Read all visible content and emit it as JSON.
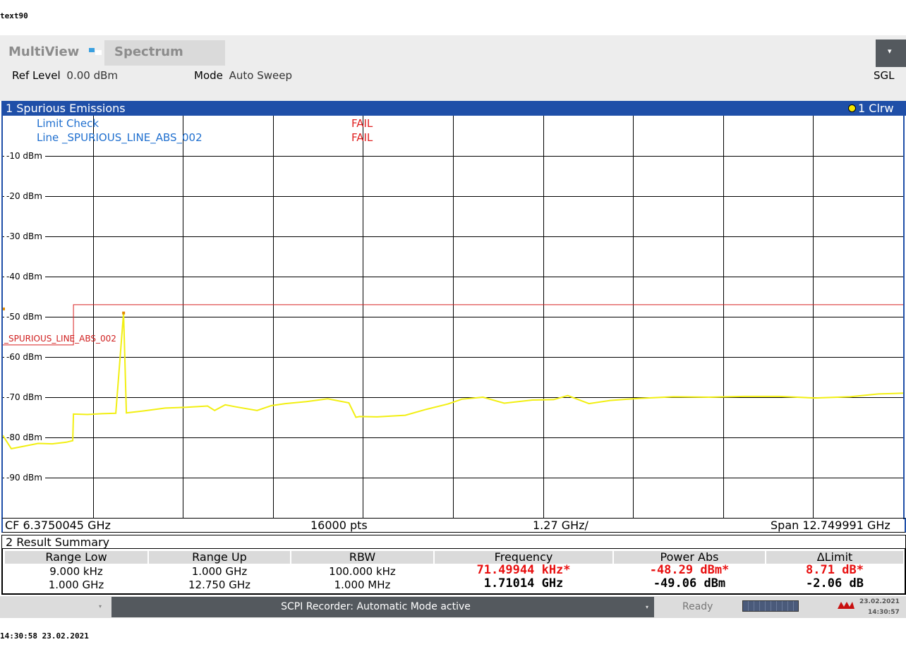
{
  "captions": {
    "top": "text90",
    "bottom": "14:30:58  23.02.2021"
  },
  "header": {
    "app": "MultiView",
    "tab": "Spectrum",
    "ref_level_label": "Ref Level",
    "ref_level_value": "0.00 dBm",
    "mode_label": "Mode",
    "mode_value": "Auto Sweep",
    "sgl": "SGL",
    "menu_glyph": "▾"
  },
  "window1": {
    "title": "1 Spurious Emissions",
    "trace_label": "1 Clrw",
    "limit_check_label": "Limit Check",
    "limit_check_result": "FAIL",
    "limit_line_label": "Line _SPURIOUS_LINE_ABS_002",
    "limit_line_result": "FAIL",
    "line_marker_label": "_SPURIOUS_LINE_ABS_002",
    "footer": {
      "cf": "CF 6.3750045 GHz",
      "pts": "16000 pts",
      "div": "1.27 GHz/",
      "span": "Span 12.749991 GHz"
    }
  },
  "chart_data": {
    "type": "line",
    "y_unit": "dBm",
    "ylim": [
      -100,
      0
    ],
    "xlim_ghz": [
      0.0,
      12.75
    ],
    "yticks": [
      "-10 dBm",
      "-20 dBm",
      "-30 dBm",
      "-40 dBm",
      "-50 dBm",
      "-60 dBm",
      "-70 dBm",
      "-80 dBm",
      "-90 dBm"
    ],
    "ytick_values": [
      -10,
      -20,
      -30,
      -40,
      -50,
      -60,
      -70,
      -80,
      -90
    ],
    "grid": true,
    "colors": {
      "trace": "#f2ef12",
      "limit": "#d82020",
      "marker": "#e08a00",
      "grid": "#000000"
    },
    "series": [
      {
        "x_ghz": [
          0.0,
          0.12,
          0.3,
          0.5,
          0.7,
          0.9,
          0.99,
          1.0,
          1.2,
          1.4,
          1.6,
          1.7101,
          1.75,
          2.0,
          2.3,
          2.6,
          2.9,
          3.0,
          3.15,
          3.3,
          3.6,
          3.8,
          4.0,
          4.3,
          4.6,
          4.9,
          5.0,
          5.05,
          5.3,
          5.7,
          6.0,
          6.3,
          6.5,
          6.8,
          7.1,
          7.5,
          7.8,
          8.0,
          8.3,
          8.6,
          9.0,
          9.5,
          10.0,
          10.5,
          11.0,
          11.5,
          12.0,
          12.4,
          12.75
        ],
        "y_dbm": [
          -79.5,
          -82.8,
          -82.2,
          -81.5,
          -81.6,
          -81.2,
          -80.8,
          -74.2,
          -74.3,
          -74.1,
          -74.0,
          -49.06,
          -73.9,
          -73.4,
          -72.7,
          -72.5,
          -72.2,
          -73.3,
          -71.9,
          -72.4,
          -73.3,
          -72.1,
          -71.6,
          -71.1,
          -70.4,
          -71.4,
          -75.0,
          -74.8,
          -74.9,
          -74.5,
          -73.0,
          -71.7,
          -70.5,
          -70.0,
          -71.5,
          -70.7,
          -70.6,
          -69.6,
          -71.6,
          -70.8,
          -70.3,
          -69.9,
          -70.0,
          -69.8,
          -69.8,
          -70.2,
          -69.9,
          -69.2,
          -69.0
        ]
      }
    ],
    "limit_line": {
      "x_ghz": [
        0.0,
        1.0,
        1.0,
        12.75
      ],
      "y_dbm": [
        -57.0,
        -57.0,
        -47.0,
        -47.0
      ]
    },
    "marker": {
      "x_ghz": 1.71014,
      "y_dbm": -49.06
    }
  },
  "window2": {
    "title": "2 Result Summary",
    "columns": [
      "Range Low",
      "Range Up",
      "RBW",
      "Frequency",
      "Power Abs",
      "ΔLimit"
    ],
    "rows": [
      [
        "9.000 kHz",
        "1.000 GHz",
        "100.000 kHz",
        "71.49944 kHz*",
        "-48.29 dBm*",
        "8.71 dB*"
      ],
      [
        "1.000 GHz",
        "12.750 GHz",
        "1.000 MHz",
        "1.71014 GHz",
        "-49.06 dBm",
        "-2.06 dB"
      ]
    ]
  },
  "statusbar": {
    "scpi": "SCPI Recorder: Automatic Mode active",
    "ready": "Ready",
    "date": "23.02.2021",
    "time": "14:30:57",
    "arrow": "▾"
  }
}
